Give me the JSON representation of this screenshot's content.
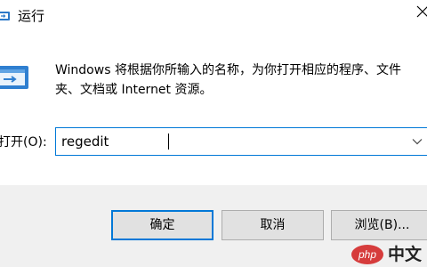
{
  "window": {
    "title": "运行",
    "icons": {
      "title": "run-icon",
      "close": "close-icon",
      "app": "run-app-icon"
    }
  },
  "dialog": {
    "description": "Windows 将根据你所输入的名称，为你打开相应的程序、文件夹、文档或 Internet 资源。",
    "open_label": "打开(O):",
    "input_value": "regedit",
    "dropdown_icon": "chevron-down-icon"
  },
  "buttons": {
    "ok": "确定",
    "cancel": "取消",
    "browse": "浏览(B)..."
  },
  "colors": {
    "accent": "#0078d7",
    "footer_bg": "#f0f0f0",
    "button_bg": "#e1e1e1",
    "button_border": "#adadad",
    "watermark_logo": "#d63c3c"
  },
  "watermark": {
    "logo_text": "php",
    "text": "中文"
  }
}
